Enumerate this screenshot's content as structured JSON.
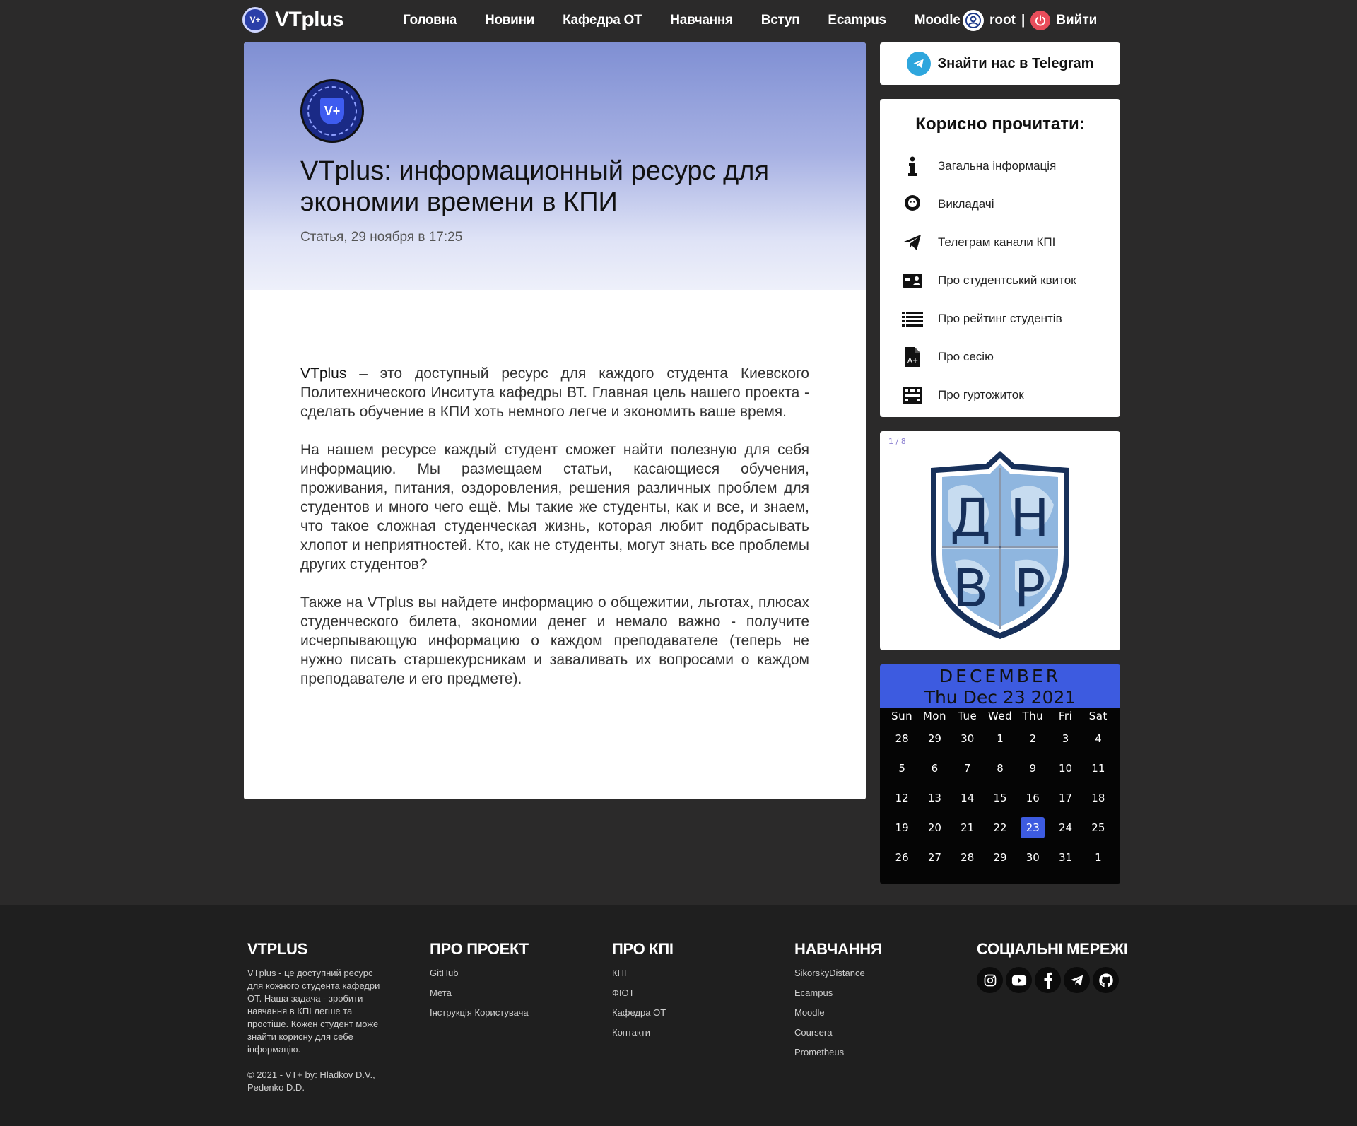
{
  "header": {
    "brand_name": "VTplus",
    "brand_logo_text": "V+",
    "nav": [
      "Головна",
      "Новини",
      "Кафедра ОТ",
      "Навчання",
      "Вступ",
      "Ecampus",
      "Moodle"
    ],
    "user_name": "root",
    "separator": "|",
    "logout_label": "Вийти"
  },
  "article": {
    "logo_text": "V+",
    "title": "VTplus: информационный ресурс для экономии времени в КПИ",
    "meta": "Статья, 29 ноября в 17:25",
    "lead_word": "VTplus",
    "p1_rest": " – это доступный ресурс для каждого студента Киевского Политехнического Инситута кафедры ВТ. Главная цель нашего проекта - сделать обучение в КПИ хоть немного легче и экономить ваше время.",
    "p2": "На нашем ресурсе каждый студент сможет найти полезную для себя информацию. Мы размещаем статьи, касающиеся обучения, проживания, питания, оздоровления, решения различных проблем для студентов и много чего ещё. Мы такие же студенты, как и все, и знаем, что такое сложная студенческая жизнь, которая любит подбрасывать хлопот и неприятностей. Кто, как не студенты, могут знать все проблемы других студентов?",
    "p3": "Также на VTplus вы найдете информацию о общежитии, льготах, плюсах студенческого билета, экономии денег и немало важно - получите исчерпывающую информацию о каждом преподавателе (теперь не нужно писать старшекурсникам и заваливать их вопросами о каждом преподавателе и его предмете)."
  },
  "sidebar": {
    "telegram_label": "Знайти нас в Telegram",
    "useful_title": "Корисно прочитати:",
    "useful_items": [
      {
        "label": "Загальна інформація",
        "icon": "info-icon"
      },
      {
        "label": "Викладачі",
        "icon": "teacher-icon"
      },
      {
        "label": "Телеграм канали КПІ",
        "icon": "paper-plane-icon"
      },
      {
        "label": "Про студентський квиток",
        "icon": "id-card-icon"
      },
      {
        "label": "Про рейтинг студентів",
        "icon": "list-icon"
      },
      {
        "label": "Про сесію",
        "icon": "grade-file-icon"
      },
      {
        "label": "Про гуртожиток",
        "icon": "dormitory-icon"
      }
    ],
    "slider_counter": "1 / 8",
    "slide_letters": [
      "Д",
      "Н",
      "В",
      "Р"
    ]
  },
  "calendar": {
    "month": "DECEMBER",
    "date_label": "Thu Dec 23 2021",
    "weekdays": [
      "Sun",
      "Mon",
      "Tue",
      "Wed",
      "Thu",
      "Fri",
      "Sat"
    ],
    "days": [
      "28",
      "29",
      "30",
      "1",
      "2",
      "3",
      "4",
      "5",
      "6",
      "7",
      "8",
      "9",
      "10",
      "11",
      "12",
      "13",
      "14",
      "15",
      "16",
      "17",
      "18",
      "19",
      "20",
      "21",
      "22",
      "23",
      "24",
      "25",
      "26",
      "27",
      "28",
      "29",
      "30",
      "31",
      "1"
    ],
    "today": "23",
    "accent_color": "#3d5be0"
  },
  "footer": {
    "about_title": "VTPLUS",
    "about_text": "VTplus - це доступний ресурс для кожного студента кафедри ОТ. Наша задача - зробити навчання в КПІ легше та простіше. Кожен студент може знайти корисну для себе інформацію.",
    "copyright": "© 2021 - VT+ by: Hladkov D.V., Pedenko D.D.",
    "project_title": "ПРО ПРОЕКТ",
    "project_links": [
      "GitHub",
      "Мета",
      "Інструкція Користувача"
    ],
    "kpi_title": "ПРО КПІ",
    "kpi_links": [
      "КПІ",
      "ФІОТ",
      "Кафедра ОТ",
      "Контакти"
    ],
    "study_title": "НАВЧАННЯ",
    "study_links": [
      "SikorskyDistance",
      "Ecampus",
      "Moodle",
      "Coursera",
      "Prometheus"
    ],
    "social_title": "СОЦІАЛЬНІ МЕРЕЖІ",
    "socials": [
      "instagram-icon",
      "youtube-icon",
      "facebook-icon",
      "telegram-icon",
      "github-icon"
    ]
  }
}
